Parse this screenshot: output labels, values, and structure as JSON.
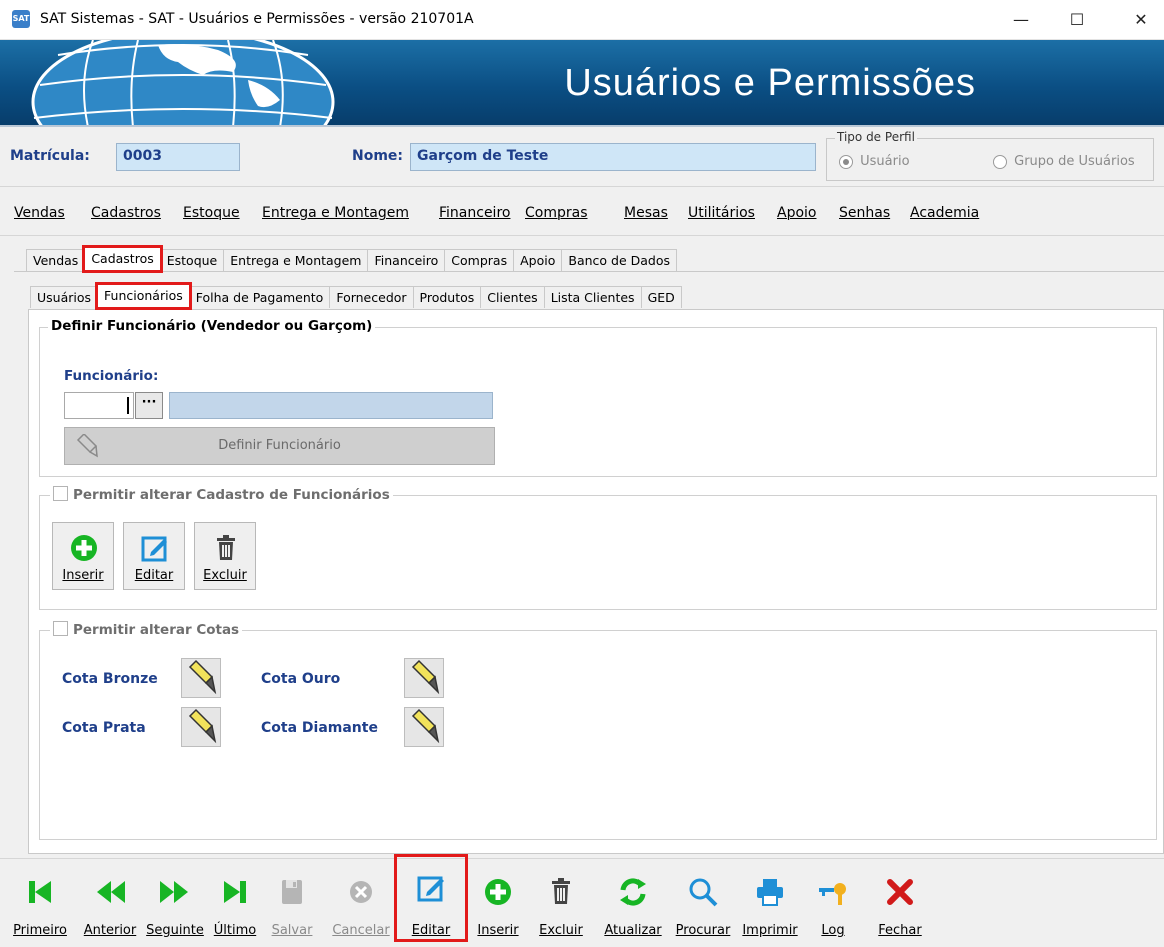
{
  "window": {
    "title": "SAT Sistemas - SAT - Usuários e Permissões - versão 210701A",
    "minimize_symbol": "—",
    "maximize_symbol": "☐",
    "close_symbol": "✕"
  },
  "banner": {
    "title": "Usuários e Permissões"
  },
  "header": {
    "matricula_label": "Matrícula:",
    "matricula_value": "0003",
    "nome_label": "Nome:",
    "nome_value": "Garçom de Teste",
    "tipo_perfil": {
      "legend": "Tipo de Perfil",
      "options": [
        {
          "label": "Usuário",
          "selected": true
        },
        {
          "label": "Grupo de Usuários",
          "selected": false
        }
      ]
    }
  },
  "menu": [
    "Vendas",
    "Cadastros",
    "Estoque",
    "Entrega e Montagem",
    "Financeiro",
    "Compras",
    "Mesas",
    "Utilitários",
    "Apoio",
    "Senhas",
    "Academia"
  ],
  "tabs_level1": [
    {
      "label": "Vendas",
      "active": false
    },
    {
      "label": "Cadastros",
      "active": true
    },
    {
      "label": "Estoque",
      "active": false
    },
    {
      "label": "Entrega e Montagem",
      "active": false
    },
    {
      "label": "Financeiro",
      "active": false
    },
    {
      "label": "Compras",
      "active": false
    },
    {
      "label": "Apoio",
      "active": false
    },
    {
      "label": "Banco de Dados",
      "active": false
    }
  ],
  "tabs_level2": [
    {
      "label": "Usuários",
      "active": false
    },
    {
      "label": "Funcionários",
      "active": true
    },
    {
      "label": "Folha de Pagamento",
      "active": false
    },
    {
      "label": "Fornecedor",
      "active": false
    },
    {
      "label": "Produtos",
      "active": false
    },
    {
      "label": "Clientes",
      "active": false
    },
    {
      "label": "Lista Clientes",
      "active": false
    },
    {
      "label": "GED",
      "active": false
    }
  ],
  "definir": {
    "title": "Definir Funcionário (Vendedor ou Garçom)",
    "field_label": "Funcionário:",
    "ellipsis": "···",
    "button_label": "Definir Funcionário"
  },
  "permitir_cadastro": {
    "title": "Permitir alterar Cadastro de Funcionários",
    "buttons": {
      "inserir": "Inserir",
      "editar": "Editar",
      "excluir": "Excluir"
    }
  },
  "permitir_cotas": {
    "title": "Permitir alterar Cotas",
    "cota_bronze": "Cota Bronze",
    "cota_ouro": "Cota Ouro",
    "cota_prata": "Cota Prata",
    "cota_diamante": "Cota Diamante"
  },
  "bottom_toolbar": {
    "primeiro": "Primeiro",
    "anterior": "Anterior",
    "seguinte": "Seguinte",
    "ultimo": "Último",
    "salvar": "Salvar",
    "cancelar": "Cancelar",
    "editar": "Editar",
    "inserir": "Inserir",
    "excluir": "Excluir",
    "atualizar": "Atualizar",
    "procurar": "Procurar",
    "imprimir": "Imprimir",
    "log": "Log",
    "fechar": "Fechar"
  },
  "colors": {
    "label_blue": "#1f3f8a",
    "field_blue": "#cfe6f7",
    "green": "#17b524",
    "icon_blue": "#1e8fd6",
    "close_red": "#d11a1a",
    "highlight_red": "#e21a1a"
  }
}
